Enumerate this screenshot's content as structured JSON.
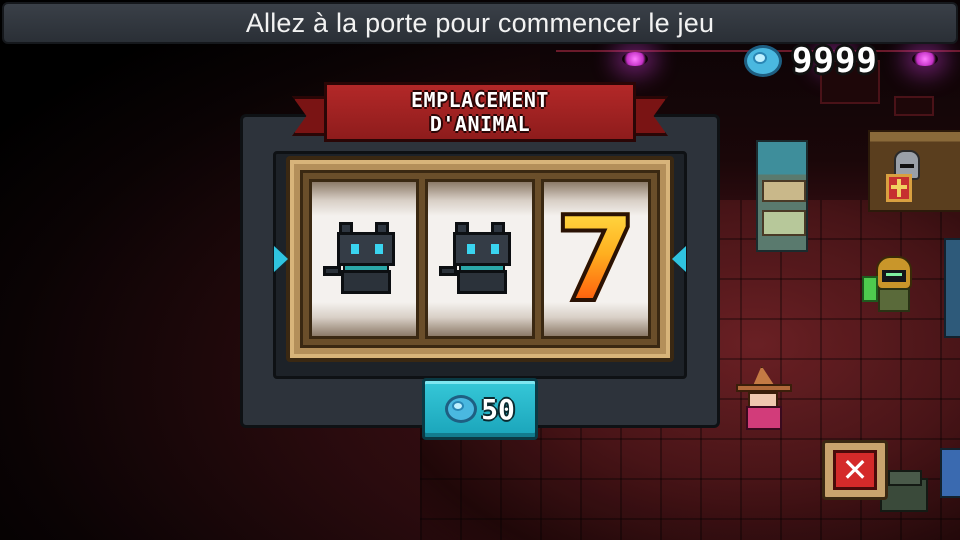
{
  "hint_banner": {
    "text": "Allez à la porte pour commencer le jeu"
  },
  "currency": {
    "icon": "gem-icon",
    "value": "9999",
    "color": "#4ab8e0"
  },
  "slot_machine": {
    "title_line1": "EMPLACEMENT",
    "title_line2": "D'ANIMAL",
    "reels": [
      {
        "symbol": "black-cat"
      },
      {
        "symbol": "black-cat"
      },
      {
        "symbol": "seven",
        "label": "7"
      }
    ],
    "spin_cost": "50",
    "spin_icon": "gem-icon"
  },
  "close_button": {
    "icon": "close-icon",
    "label": "✕"
  },
  "colors": {
    "ribbon": "#a82222",
    "frame": "#b48f5a",
    "spin_button": "#28b8cc",
    "close_button": "#d42a2a"
  }
}
